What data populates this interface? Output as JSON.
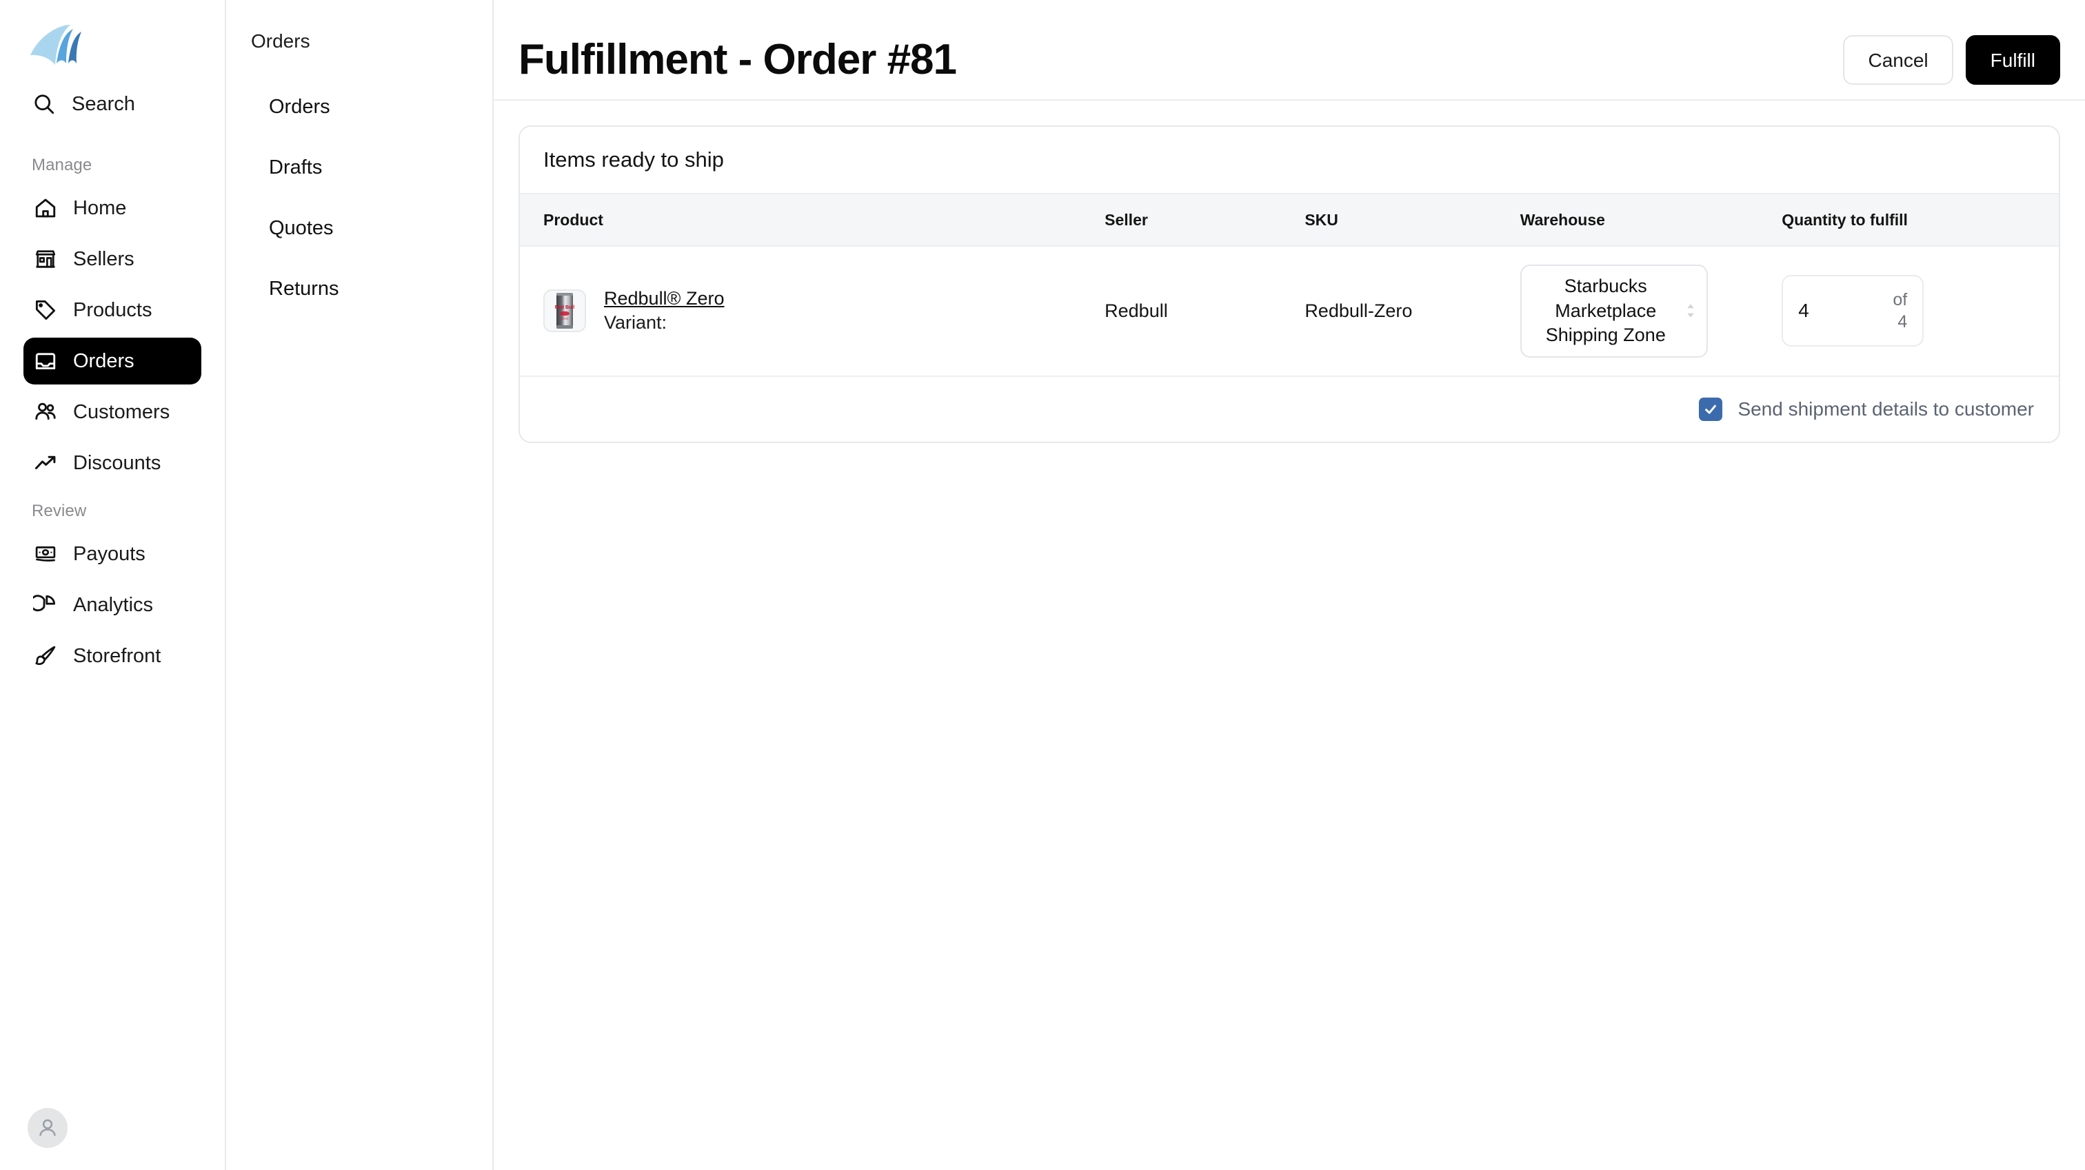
{
  "brand": {
    "logo_name": "wave-sail-logo",
    "colors": {
      "light": "#a9d6ee",
      "mid": "#57a4e0",
      "dark": "#3a78b5"
    }
  },
  "sidebar": {
    "search": {
      "label": "Search",
      "icon": "search-icon"
    },
    "groups": [
      {
        "label": "Manage",
        "items": [
          {
            "label": "Home",
            "icon": "house-icon",
            "active": false
          },
          {
            "label": "Sellers",
            "icon": "storefront-icon",
            "active": false
          },
          {
            "label": "Products",
            "icon": "tag-icon",
            "active": false
          },
          {
            "label": "Orders",
            "icon": "inbox-icon",
            "active": true
          },
          {
            "label": "Customers",
            "icon": "users-icon",
            "active": false
          },
          {
            "label": "Discounts",
            "icon": "trending-up-icon",
            "active": false
          }
        ]
      },
      {
        "label": "Review",
        "items": [
          {
            "label": "Payouts",
            "icon": "banknote-icon",
            "active": false
          },
          {
            "label": "Analytics",
            "icon": "pie-chart-icon",
            "active": false
          },
          {
            "label": "Storefront",
            "icon": "paintbrush-icon",
            "active": false
          }
        ]
      }
    ],
    "avatar": {
      "icon": "user-avatar-icon"
    }
  },
  "subnav": {
    "title": "Orders",
    "items": [
      {
        "label": "Orders"
      },
      {
        "label": "Drafts"
      },
      {
        "label": "Quotes"
      },
      {
        "label": "Returns"
      }
    ]
  },
  "header": {
    "title": "Fulfillment - Order #81",
    "cancel_label": "Cancel",
    "fulfill_label": "Fulfill"
  },
  "card": {
    "title": "Items ready to ship",
    "columns": [
      "Product",
      "Seller",
      "SKU",
      "Warehouse",
      "Quantity to fulfill"
    ],
    "rows": [
      {
        "product_name": "Redbull® Zero",
        "variant_label": "Variant:",
        "variant_value": "",
        "thumbnail": "redbull-can-thumbnail",
        "seller": "Redbull",
        "sku": "Redbull-Zero",
        "warehouse": "Starbucks Marketplace Shipping Zone",
        "quantity_value": "4",
        "quantity_of": "of\n4"
      }
    ],
    "footer": {
      "checkbox_label": "Send shipment details to customer",
      "checked": true,
      "checkbox_color": "#3b6bad"
    }
  }
}
